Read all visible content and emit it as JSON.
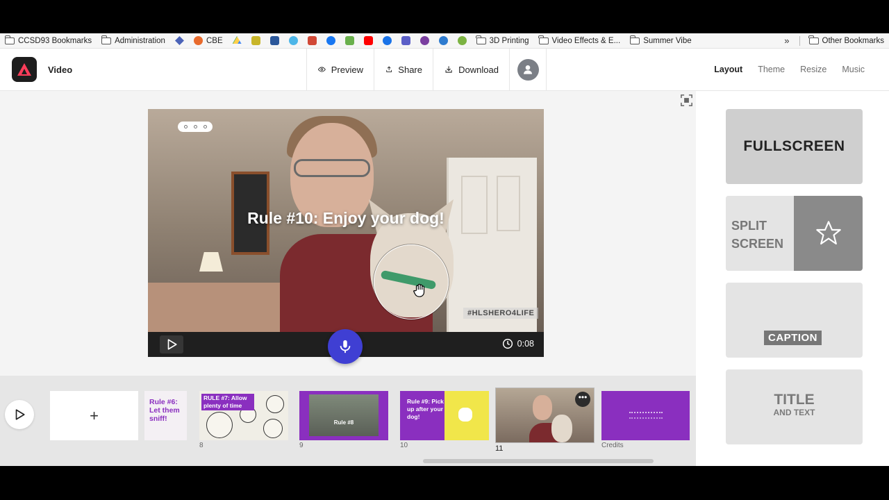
{
  "bookmarks": {
    "items": [
      {
        "label": "CCSD93 Bookmarks",
        "icon": "folder-icon"
      },
      {
        "label": "Administration",
        "icon": "folder-icon"
      },
      {
        "label": "CBE",
        "icon": "cbe-favicon"
      },
      {
        "label": "3D Printing",
        "icon": "folder-icon"
      },
      {
        "label": "Video Effects & E...",
        "icon": "folder-icon"
      },
      {
        "label": "Summer Vibe",
        "icon": "folder-icon"
      }
    ],
    "overflow": "»",
    "other": "Other Bookmarks",
    "favicon_colors": [
      "#4b63b8",
      "#1f9d55",
      "#e8a317",
      "#2b579a",
      "#4db6e8",
      "#d14836",
      "#1877f2",
      "#6ab04c",
      "#ff0000",
      "#1a73e8",
      "#5b5fc7",
      "#7b3fa0",
      "#2e7bcf",
      "#7cb342"
    ]
  },
  "header": {
    "title": "Video",
    "preview": "Preview",
    "share": "Share",
    "download": "Download",
    "tabs": [
      "Layout",
      "Theme",
      "Resize",
      "Music"
    ],
    "active_tab": "Layout"
  },
  "stage": {
    "caption": "Rule #10: Enjoy your dog!",
    "hashtag": "#HLSHERO4LIFE",
    "time": "0:08"
  },
  "layouts": {
    "fullscreen": "FULLSCREEN",
    "split_line1": "SPLIT",
    "split_line2": "SCREEN",
    "caption": "CAPTION",
    "title_line1": "TITLE",
    "title_line2": "AND TEXT"
  },
  "timeline": {
    "add": "+",
    "slides": [
      {
        "text": "Rule #6: Let them sniff!",
        "number": ""
      },
      {
        "text": "RULE #7: Allow plenty of time",
        "number": "8"
      },
      {
        "text": "Rule #8",
        "number": "9"
      },
      {
        "text": "Rule #9: Pick up after your dog!",
        "number": "10"
      },
      {
        "text": "",
        "number": "11"
      },
      {
        "text": "",
        "number": "Credits"
      }
    ]
  },
  "colors": {
    "accent": "#3f3fd3",
    "slide_purple": "#8a2fbf",
    "slide_yellow": "#f1e64a"
  }
}
